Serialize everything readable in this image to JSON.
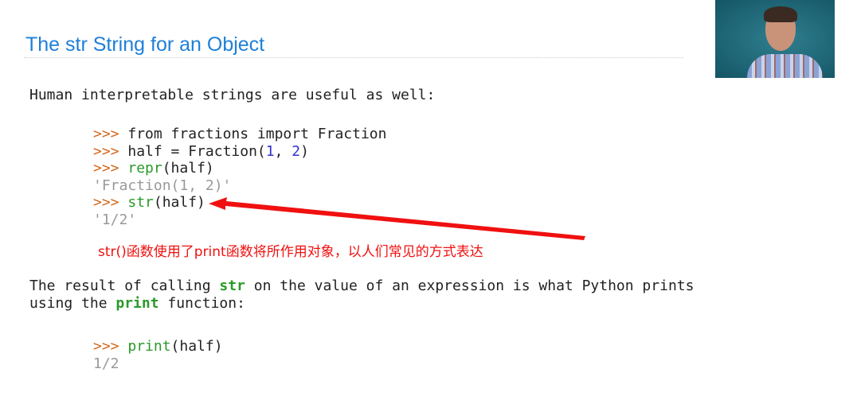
{
  "slide": {
    "title": "The str String for an Object",
    "intro": "Human interpretable strings are useful as well:",
    "code1": [
      {
        "prompt": ">>>",
        "parts": [
          "from fractions import Fraction"
        ]
      },
      {
        "prompt": ">>>",
        "pre": "half = Fraction(",
        "n1": "1",
        ",": ", ",
        "n2": "2",
        "post": ")"
      },
      {
        "prompt": ">>>",
        "fn": "repr",
        "args": "(half)"
      },
      {
        "output": "'Fraction(1, 2)'"
      },
      {
        "prompt": ">>>",
        "fn": "str",
        "args": "(half)"
      },
      {
        "output": "'1/2'"
      }
    ],
    "annotation": "str()函数使用了print函数将所作用对象，以人们常见的方式表达",
    "result_line1_a": "The result of calling ",
    "result_line1_kw": "str",
    "result_line1_b": " on the value of an expression is what Python prints",
    "result_line2_a": "using the ",
    "result_line2_kw": "print",
    "result_line2_b": " function:",
    "code2": [
      {
        "prompt": ">>>",
        "fn": "print",
        "args": "(half)"
      },
      {
        "output": "1/2"
      }
    ]
  },
  "colors": {
    "title": "#1f7fd8",
    "arrow": "#f01010",
    "prompt": "#d2691e"
  }
}
